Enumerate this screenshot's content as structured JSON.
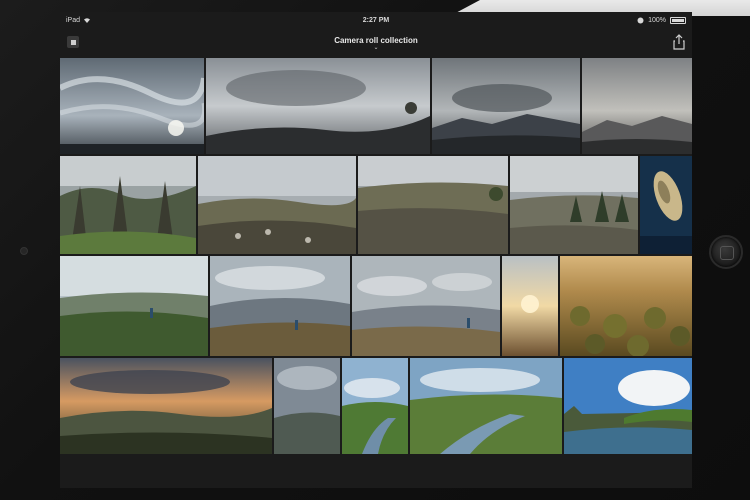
{
  "status": {
    "device": "iPad",
    "time": "2:27 PM",
    "battery": "100%",
    "battery_level": 1.0
  },
  "nav": {
    "title": "Camera roll collection"
  },
  "photos": [
    {
      "name": "cloudy-sky-sun"
    },
    {
      "name": "stormy-sky-hills"
    },
    {
      "name": "mountain-range-clouds"
    },
    {
      "name": "hazy-mountains"
    },
    {
      "name": "forest-trees"
    },
    {
      "name": "rocky-hillside"
    },
    {
      "name": "rocky-plain"
    },
    {
      "name": "plain-with-trees"
    },
    {
      "name": "fish-underwater"
    },
    {
      "name": "hiker-green-hills"
    },
    {
      "name": "hiker-valley-clouds"
    },
    {
      "name": "hiker-valley-haze"
    },
    {
      "name": "sunset-glow"
    },
    {
      "name": "golden-shrubland"
    },
    {
      "name": "dramatic-sunset-hills"
    },
    {
      "name": "cloudy-valley"
    },
    {
      "name": "river-valley-1"
    },
    {
      "name": "river-valley-2"
    },
    {
      "name": "river-blue-sky"
    }
  ]
}
